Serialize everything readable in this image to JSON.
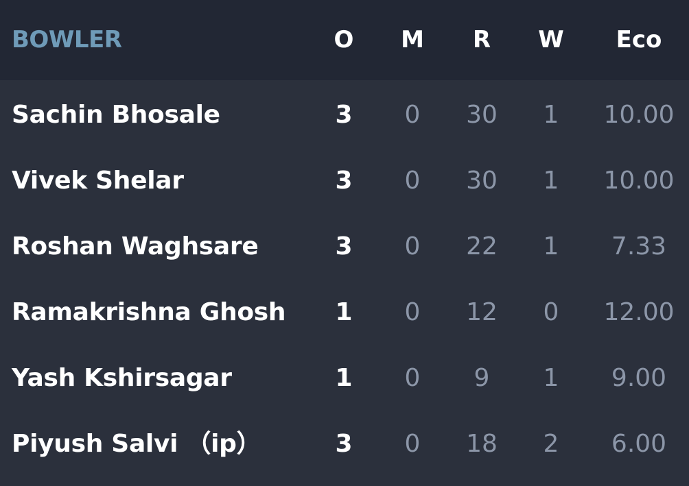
{
  "header": {
    "bowler": "BOWLER",
    "o": "O",
    "m": "M",
    "r": "R",
    "w": "W",
    "eco": "Eco"
  },
  "rows": [
    {
      "name": "Sachin Bhosale",
      "o": "3",
      "m": "0",
      "r": "30",
      "w": "1",
      "eco": "10.00"
    },
    {
      "name": "Vivek Shelar",
      "o": "3",
      "m": "0",
      "r": "30",
      "w": "1",
      "eco": "10.00"
    },
    {
      "name": "Roshan Waghsare",
      "o": "3",
      "m": "0",
      "r": "22",
      "w": "1",
      "eco": "7.33"
    },
    {
      "name": "Ramakrishna Ghosh",
      "o": "1",
      "m": "0",
      "r": "12",
      "w": "0",
      "eco": "12.00"
    },
    {
      "name": "Yash Kshirsagar",
      "o": "1",
      "m": "0",
      "r": "9",
      "w": "1",
      "eco": "9.00"
    },
    {
      "name": "Piyush Salvi （ip）",
      "o": "3",
      "m": "0",
      "r": "18",
      "w": "2",
      "eco": "6.00"
    }
  ],
  "colors": {
    "background": "#2b303c",
    "header_background": "#222734",
    "bowler_header": "#6f9bb8",
    "primary_text": "#ffffff",
    "muted_text": "#8c96a8"
  }
}
